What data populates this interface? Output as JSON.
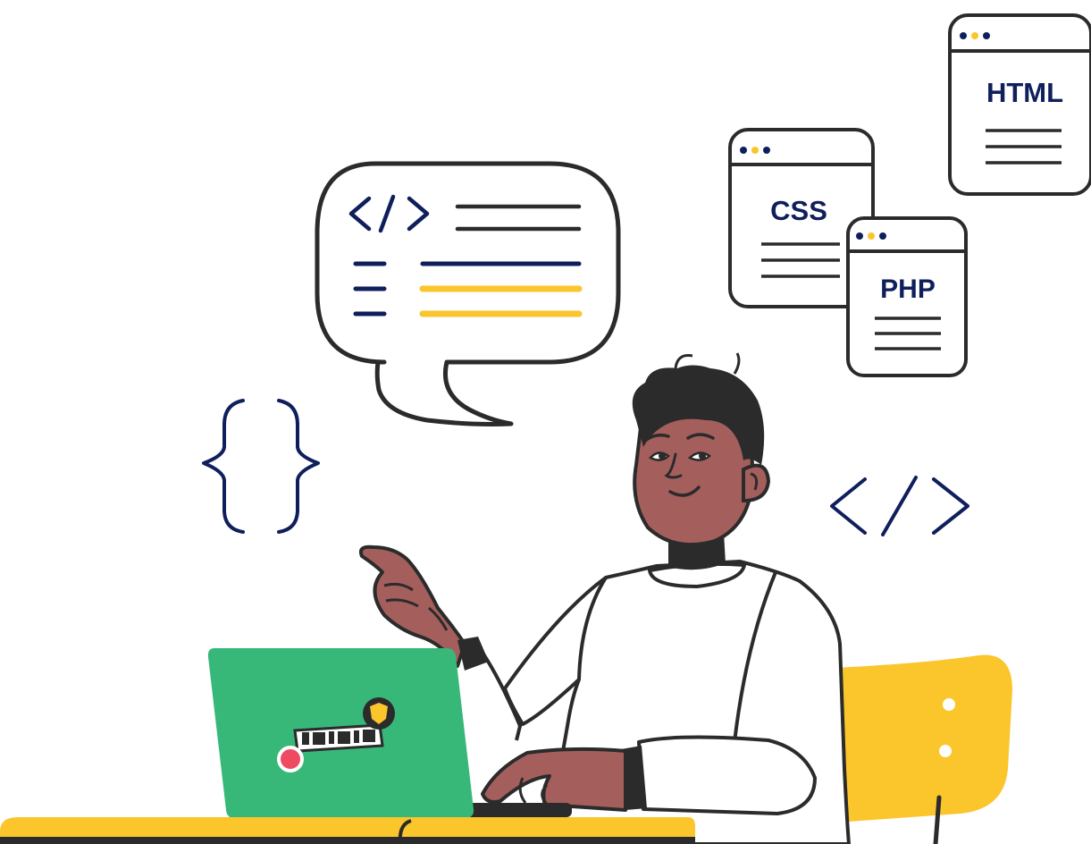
{
  "colors": {
    "outline": "#2b2b2b",
    "navy": "#0f1f5c",
    "accent_yellow": "#fbc52c",
    "laptop_green": "#37b879",
    "skin": "#a45f5d",
    "shirt": "#ffffff",
    "sticker_red": "#ee4a62"
  },
  "windows": {
    "html": {
      "label": "HTML"
    },
    "css": {
      "label": "CSS"
    },
    "php": {
      "label": "PHP"
    }
  },
  "icons": {
    "code_tag_bubble": "code-tag-icon",
    "code_tag_floating": "code-tag-icon",
    "curly_braces": "curly-braces-icon",
    "laptop_sticker": "laptop-sticker-icon"
  }
}
